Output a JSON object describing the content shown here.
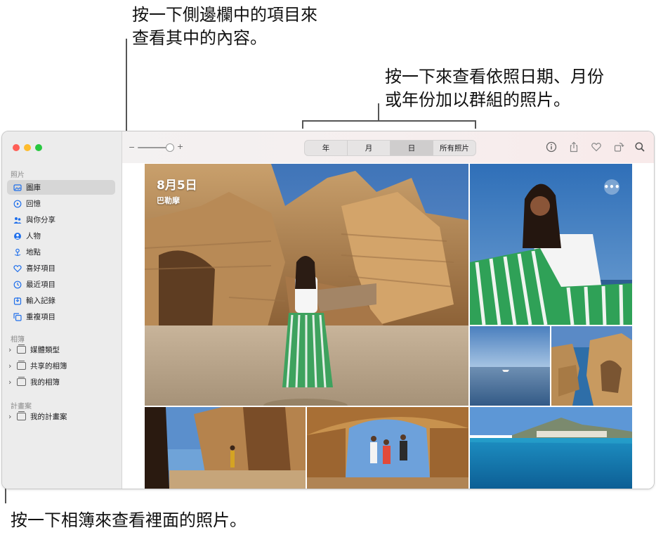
{
  "callouts": {
    "top_line1": "按一下側邊欄中的項目來",
    "top_line2": "查看其中的內容。",
    "right_line1": "按一下來查看依照日期、月份",
    "right_line2": "或年份加以群組的照片。",
    "bottom": "按一下相簿來查看裡面的照片。"
  },
  "sidebar": {
    "section_photos": "照片",
    "items": [
      {
        "label": "圖庫",
        "icon": "library-icon",
        "selected": true
      },
      {
        "label": "回憶",
        "icon": "memories-icon"
      },
      {
        "label": "與你分享",
        "icon": "shared-with-you-icon"
      },
      {
        "label": "人物",
        "icon": "people-icon"
      },
      {
        "label": "地點",
        "icon": "places-icon"
      },
      {
        "label": "喜好項目",
        "icon": "heart-icon"
      },
      {
        "label": "最近項目",
        "icon": "clock-icon"
      },
      {
        "label": "輸入記錄",
        "icon": "import-icon"
      },
      {
        "label": "重複項目",
        "icon": "duplicates-icon"
      }
    ],
    "section_albums": "相簿",
    "albums": [
      {
        "label": "媒體類型",
        "icon": "album-stack-icon"
      },
      {
        "label": "共享的相簿",
        "icon": "shared-album-icon"
      },
      {
        "label": "我的相簿",
        "icon": "album-stack-icon"
      }
    ],
    "section_projects": "計畫案",
    "projects": [
      {
        "label": "我的計畫案",
        "icon": "album-stack-icon"
      }
    ]
  },
  "toolbar": {
    "zoom_minus": "−",
    "zoom_plus": "+",
    "tabs": [
      "年",
      "月",
      "日",
      "所有照片"
    ],
    "active_tab": "日",
    "icons": [
      "info-icon",
      "share-icon",
      "heart-icon",
      "rotate-icon",
      "search-icon"
    ]
  },
  "main": {
    "date_title": "8月5日",
    "location": "巴勒摩",
    "more": "•••"
  },
  "colors": {
    "close": "#ff5f57",
    "minimize": "#febc2e",
    "zoom": "#28c840",
    "accent": "#1f6feb"
  }
}
